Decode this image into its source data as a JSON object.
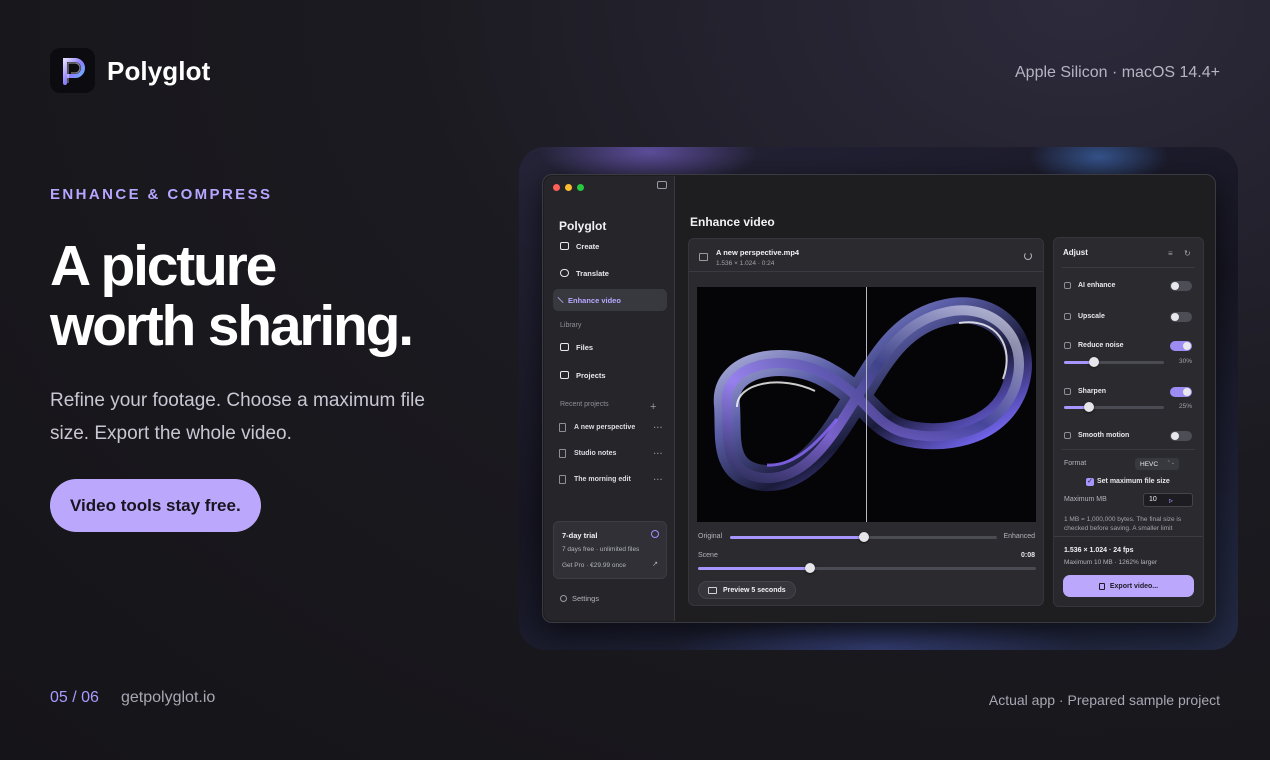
{
  "brand": {
    "name": "Polyglot",
    "logo_letter": "P",
    "platform": "Apple Silicon · macOS 14.4+"
  },
  "hero": {
    "eyebrow": "ENHANCE & COMPRESS",
    "headline_line1": "A picture",
    "headline_line2": "worth sharing.",
    "subtext": "Refine your footage. Choose a maximum file size. Export the whole video.",
    "cta": "Video tools stay free."
  },
  "footer": {
    "pager": "05 / 06",
    "site": "getpolyglot.io",
    "footnote": "Actual app · Prepared sample project"
  },
  "app": {
    "sidebar": {
      "title": "Polyglot",
      "items": [
        {
          "label": "Create",
          "icon": "plus-square-icon"
        },
        {
          "label": "Translate",
          "icon": "chat-icon"
        },
        {
          "label": "Enhance video",
          "icon": "magic-wand-icon",
          "active": true
        }
      ],
      "library_label": "Library",
      "library": [
        {
          "label": "Files",
          "icon": "files-icon"
        },
        {
          "label": "Projects",
          "icon": "folder-icon"
        }
      ],
      "recent_label": "Recent projects",
      "recent": [
        "A new perspective",
        "Studio notes",
        "The morning edit"
      ],
      "more": "···",
      "add": "+",
      "trial": {
        "title": "7-day trial",
        "line": "7 days free · unlimited files",
        "pro": "Get Pro · €29.99 once",
        "arrow": "↗"
      },
      "settings": "Settings"
    },
    "main": {
      "title": "Enhance video",
      "file_name": "A new perspective.mp4",
      "file_meta": "1.536 × 1.024 · 0:24",
      "compare": {
        "left": "Original",
        "right": "Enhanced",
        "position": 0.5
      },
      "scene": {
        "label": "Scene",
        "time": "0:08",
        "progress": 0.33
      },
      "preview_button": "Preview 5 seconds"
    },
    "adjust": {
      "title": "Adjust",
      "icons": {
        "list": "≡",
        "reset": "↻"
      },
      "rows": [
        {
          "label": "AI enhance",
          "icon": "sparkle-icon",
          "on": false
        },
        {
          "label": "Upscale",
          "icon": "expand-icon",
          "on": false
        },
        {
          "label": "Reduce noise",
          "icon": "noise-icon",
          "on": true,
          "value_text": "30%",
          "value": 0.3
        },
        {
          "label": "Sharpen",
          "icon": "sharpen-icon",
          "on": true,
          "value_text": "25%",
          "value": 0.25
        },
        {
          "label": "Smooth motion",
          "icon": "motion-icon",
          "on": false
        }
      ],
      "format_label": "Format",
      "format_value": "HEVC",
      "format_chevron": "⌃⌄",
      "max_size_check": "Set maximum file size",
      "max_mb_label": "Maximum MB",
      "max_mb_value": "10",
      "note": "1 MB = 1,000,000 bytes. The final size is checked before saving. A smaller limit reduces picture quality.",
      "summary1": "1.536 × 1.024 · 24 fps",
      "summary2": "Maximum 10 MB · 1262% larger",
      "export": "Export video..."
    }
  },
  "colors": {
    "accent": "#bba8fc",
    "accent_text": "#b7a6ff",
    "background": "#1b1a20"
  }
}
